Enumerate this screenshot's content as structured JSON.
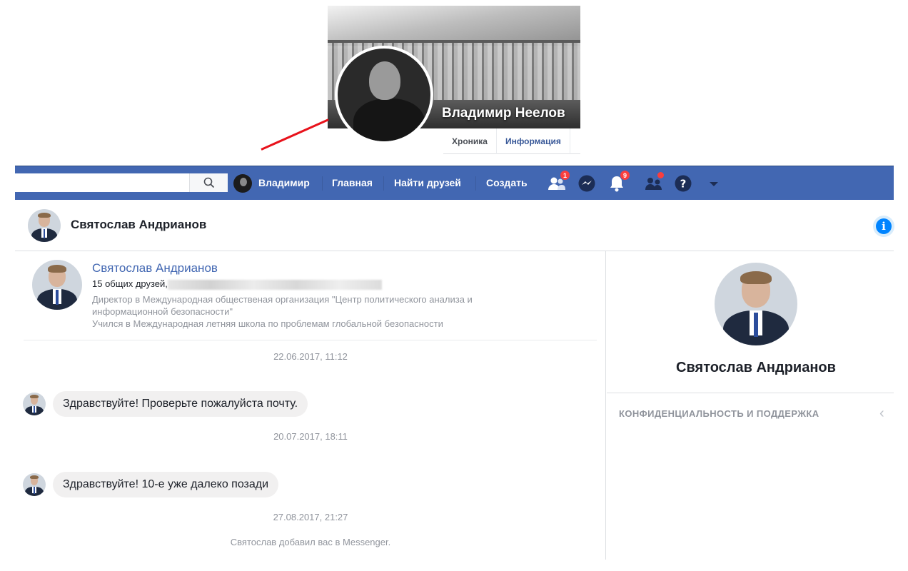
{
  "profile": {
    "name": "Владимир Неелов",
    "tabs": [
      "Хроника",
      "Информация"
    ]
  },
  "navbar": {
    "user_name": "Владимир",
    "links": [
      "Главная",
      "Найти друзей",
      "Создать"
    ],
    "badges": {
      "friend_requests": "1",
      "notifications": "9"
    },
    "icons": [
      "search-icon",
      "friend-requests-icon",
      "messenger-icon",
      "notifications-icon",
      "group-people-icon",
      "help-icon",
      "dropdown-arrow-icon"
    ]
  },
  "conversation": {
    "title": "Святослав Андрианов"
  },
  "intro": {
    "name": "Святослав Андрианов",
    "mutual_friends": "15 общих друзей,",
    "job": "Директор в Международная общественая организация \"Центр политического анализа и",
    "job_cont": "информационной безопасности\"",
    "education": "Учился в Международная летняя школа по проблемам глобальной безопасности"
  },
  "messages": [
    {
      "timestamp": "22.06.2017, 11:12",
      "text": "Здравствуйте! Проверьте пожалуйста почту."
    },
    {
      "timestamp": "20.07.2017, 18:11",
      "text": "Здравствуйте! 10-е уже далеко позади"
    }
  ],
  "last_timestamp": "27.08.2017, 21:27",
  "system_note": "Святослав добавил вас в Messenger.",
  "side_panel": {
    "name": "Святослав Андрианов",
    "section": "КОНФИДЕНЦИАЛЬНОСТЬ И ПОДДЕРЖКА"
  },
  "colors": {
    "nav_blue": "#4267b2",
    "link_blue": "#4267b2",
    "badge_red": "#fa3e3e",
    "pointer_red": "#e8121b",
    "bubble_gray": "#f1f0f0",
    "info_blue": "#0084ff"
  }
}
